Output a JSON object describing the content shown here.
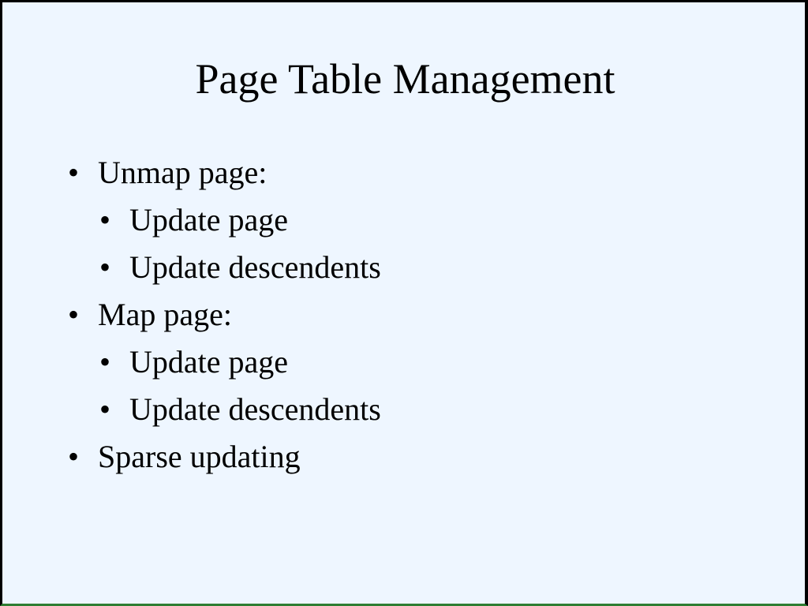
{
  "slide": {
    "title": "Page Table Management",
    "bullet_symbol": "•",
    "bullets": [
      {
        "level": 1,
        "text": "Unmap page:"
      },
      {
        "level": 2,
        "text": "Update page"
      },
      {
        "level": 2,
        "text": "Update descendents"
      },
      {
        "level": 1,
        "text": "Map page:"
      },
      {
        "level": 2,
        "text": "Update page"
      },
      {
        "level": 2,
        "text": "Update descendents"
      },
      {
        "level": 1,
        "text": "Sparse updating"
      }
    ]
  },
  "colors": {
    "background": "#eef6ff",
    "text": "#000000",
    "border": "#000000",
    "bottom_border": "#2e7d32"
  }
}
